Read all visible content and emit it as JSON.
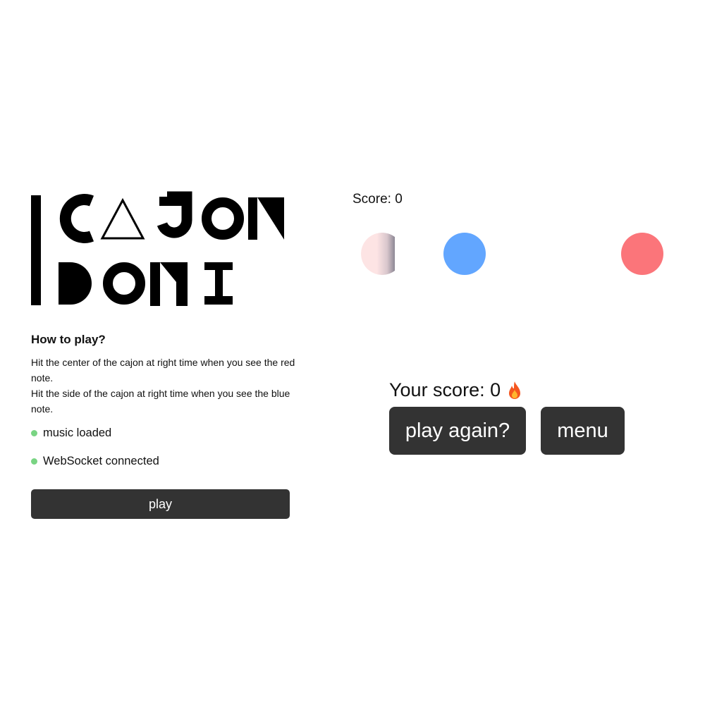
{
  "logo": {
    "line1": "CAJON",
    "line2": "DONI"
  },
  "instructions": {
    "title": "How to play?",
    "line1": "Hit the center of the cajon at right time when you see the red note.",
    "line2": "Hit the side of the cajon at right time when you see the blue note."
  },
  "status": {
    "music": "music loaded",
    "websocket": "WebSocket connected",
    "indicator_color": "#79d483"
  },
  "play_button": {
    "label": "play"
  },
  "game": {
    "score_label": "Score: 0",
    "final_score": "Your score: 0",
    "notes": [
      {
        "name": "hit-note",
        "color": "#fde4e4"
      },
      {
        "name": "blue-note",
        "color": "#62a6ff"
      },
      {
        "name": "red-note",
        "color": "#fb757a"
      }
    ],
    "play_again_label": "play again?",
    "menu_label": "menu"
  },
  "icons": {
    "score_icon": "fire-icon"
  },
  "colors": {
    "button_bg": "#333333",
    "text": "#111111"
  }
}
